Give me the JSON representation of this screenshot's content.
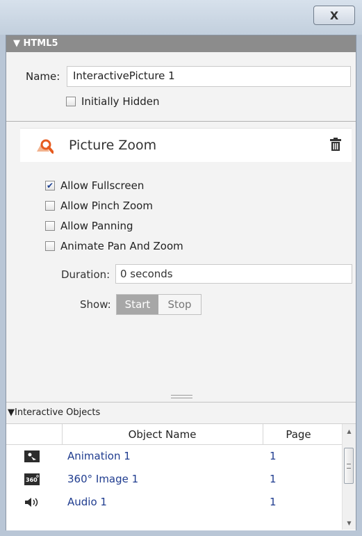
{
  "window": {
    "close_label": "X"
  },
  "html5_section": {
    "title": "▼ HTML5"
  },
  "name_field": {
    "label": "Name:",
    "value": "InteractivePicture 1"
  },
  "initially_hidden": {
    "label": "Initially Hidden",
    "checked": false
  },
  "picture_zoom": {
    "title": "Picture Zoom",
    "icon": "picture-zoom-icon",
    "delete_icon": "trash-icon",
    "options": [
      {
        "label": "Allow Fullscreen",
        "checked": true
      },
      {
        "label": "Allow Pinch Zoom",
        "checked": false
      },
      {
        "label": "Allow Panning",
        "checked": false
      },
      {
        "label": "Animate Pan And Zoom",
        "checked": false
      }
    ],
    "duration": {
      "label": "Duration:",
      "value": "0 seconds"
    },
    "show": {
      "label": "Show:",
      "options": [
        "Start",
        "Stop"
      ],
      "selected": "Start"
    }
  },
  "interactive_objects": {
    "title": "▼Interactive Objects",
    "columns": [
      "Object Name",
      "Page"
    ],
    "rows": [
      {
        "icon": "animation-icon",
        "name": "Animation 1",
        "page": "1"
      },
      {
        "icon": "360-image-icon",
        "name": "360° Image 1",
        "page": "1"
      },
      {
        "icon": "audio-icon",
        "name": "Audio 1",
        "page": "1"
      }
    ]
  },
  "colors": {
    "header_gray": "#8c8c8c",
    "link_blue": "#1f3c8f",
    "accent_orange": "#e65a1e"
  }
}
